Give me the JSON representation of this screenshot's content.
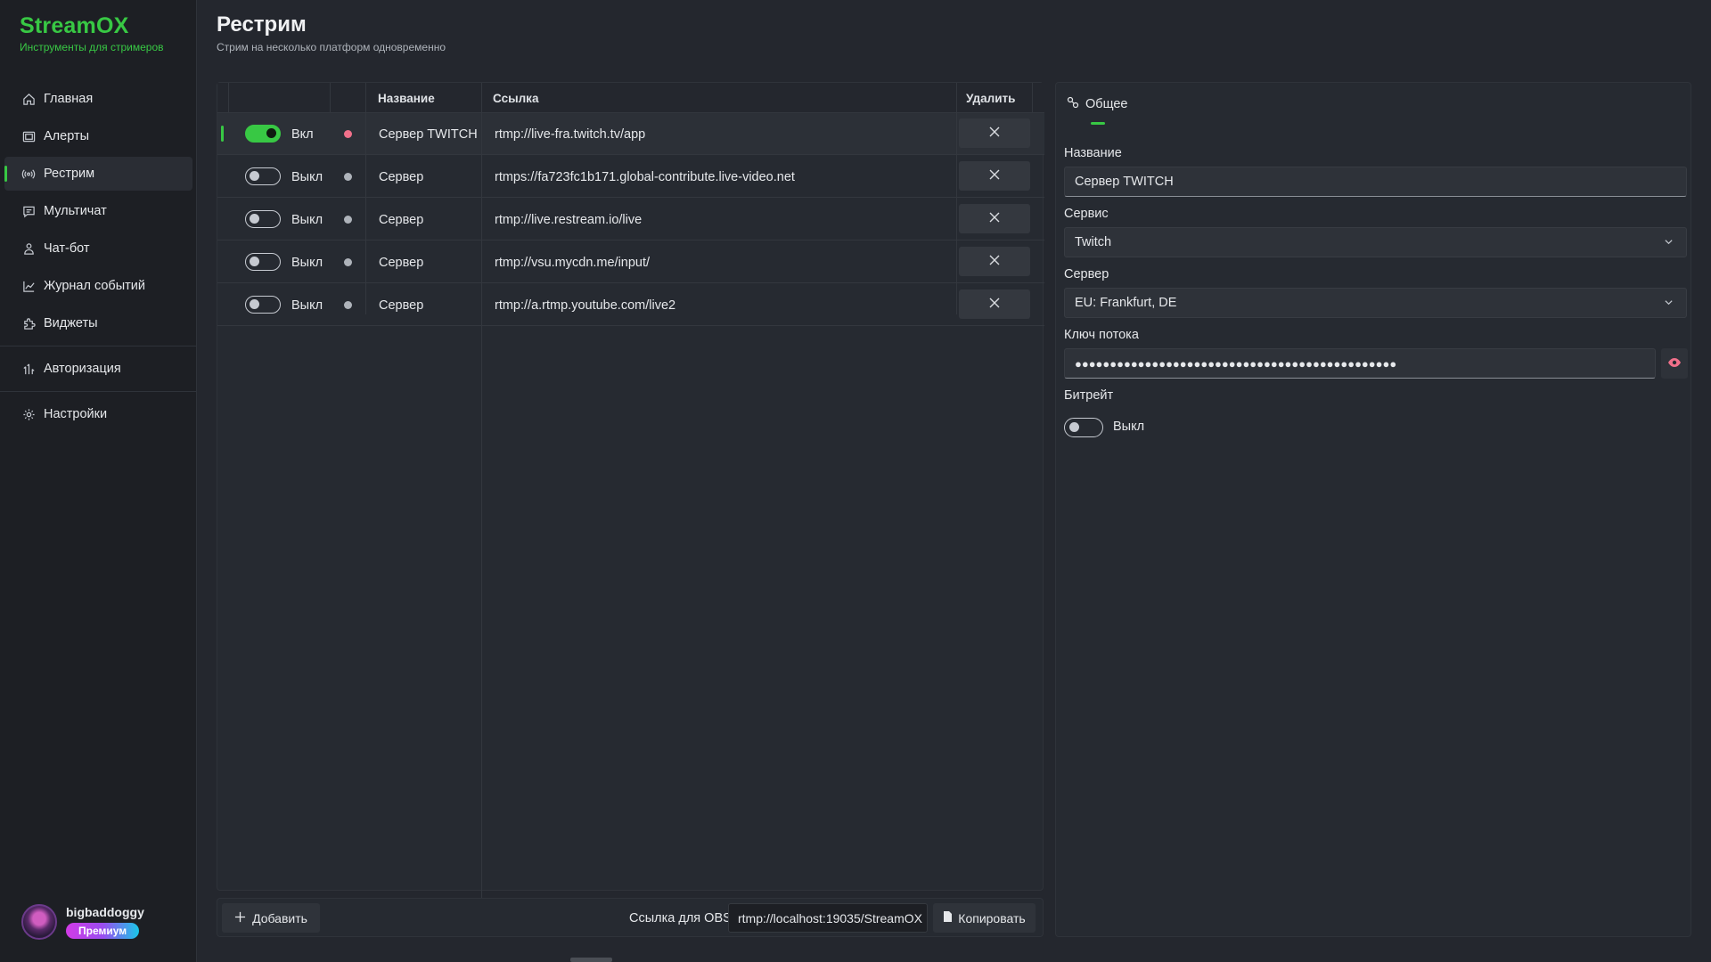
{
  "brand": {
    "title": "StreamOX",
    "subtitle": "Инструменты для стримеров"
  },
  "nav": {
    "items": [
      {
        "label": "Главная",
        "icon": "home-icon"
      },
      {
        "label": "Алерты",
        "icon": "alerts-icon"
      },
      {
        "label": "Рестрим",
        "icon": "broadcast-icon",
        "active": true
      },
      {
        "label": "Мультичат",
        "icon": "chat-icon"
      },
      {
        "label": "Чат-бот",
        "icon": "bot-icon"
      },
      {
        "label": "Журнал событий",
        "icon": "chart-icon"
      },
      {
        "label": "Виджеты",
        "icon": "puzzle-icon"
      }
    ],
    "auth_label": "Авторизация",
    "settings_label": "Настройки"
  },
  "user": {
    "name": "bigbaddoggy",
    "badge": "Премиум"
  },
  "page": {
    "title": "Рестрим",
    "subtitle": "Стрим на несколько платформ одновременно"
  },
  "table": {
    "headers": {
      "name": "Название",
      "url": "Ссылка",
      "delete": "Удалить"
    },
    "rows": [
      {
        "enabled": true,
        "state_label": "Вкл",
        "status_color": "#f0708a",
        "name": "Сервер TWITCH",
        "url": "rtmp://live-fra.twitch.tv/app",
        "selected": true
      },
      {
        "enabled": false,
        "state_label": "Выкл",
        "status_color": "#aeb3ba",
        "name": "Сервер",
        "url": "rtmps://fa723fc1b171.global-contribute.live-video.net"
      },
      {
        "enabled": false,
        "state_label": "Выкл",
        "status_color": "#aeb3ba",
        "name": "Сервер",
        "url": "rtmp://live.restream.io/live"
      },
      {
        "enabled": false,
        "state_label": "Выкл",
        "status_color": "#aeb3ba",
        "name": "Сервер",
        "url": "rtmp://vsu.mycdn.me/input/"
      },
      {
        "enabled": false,
        "state_label": "Выкл",
        "status_color": "#aeb3ba",
        "name": "Сервер",
        "url": "rtmp://a.rtmp.youtube.com/live2"
      }
    ]
  },
  "bottom": {
    "add_label": "Добавить",
    "obs_label": "Ссылка для OBS",
    "obs_url": "rtmp://localhost:19035/StreamOX",
    "copy_label": "Копировать"
  },
  "details": {
    "tab_label": "Общее",
    "name_label": "Название",
    "name_value": "Сервер TWITCH",
    "service_label": "Сервис",
    "service_value": "Twitch",
    "server_label": "Сервер",
    "server_value": "EU: Frankfurt, DE",
    "key_label": "Ключ потока",
    "key_value": "●●●●●●●●●●●●●●●●●●●●●●●●●●●●●●●●●●●●●●●●●●●●●●",
    "bitrate_label": "Битрейт",
    "bitrate_state": "Выкл"
  },
  "colors": {
    "accent": "#38c844",
    "status_live": "#f0708a",
    "background": "#24272e",
    "sidebar": "#1d1f24"
  }
}
